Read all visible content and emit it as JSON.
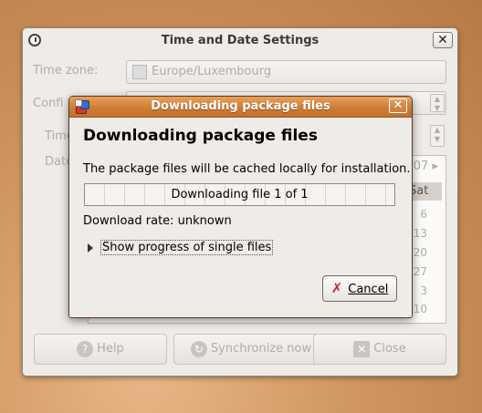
{
  "background_window": {
    "title": "Time and Date Settings",
    "close_symbol": "✕",
    "time_zone_label": "Time zone:",
    "time_zone_value": "Europe/Luxembourg",
    "config_label": "Confi",
    "time_label": "Time",
    "date_label": "Date",
    "calendar": {
      "year_fragment": "007",
      "weekday_header": "Sat",
      "day_numbers": [
        "6",
        "13",
        "20",
        "27",
        "3",
        "10"
      ]
    },
    "buttons": {
      "help": "Help",
      "synchronize": "Synchronize now",
      "close": "Close"
    }
  },
  "dialog": {
    "title": "Downloading package files",
    "heading": "Downloading package files",
    "description": "The package files will be cached locally for installation.",
    "progress": {
      "text": "Downloading file 1 of 1",
      "fraction": 0.0
    },
    "download_rate": "Download rate: unknown",
    "expander_label": "Show progress of single files",
    "cancel_label": "Cancel",
    "close_symbol": "✕"
  },
  "colors": {
    "titlebar_accent": "#cf7c36",
    "window_bg": "#efebe7",
    "cancel_icon": "#cc2222"
  },
  "icons": {
    "dialog_app": "package-icon",
    "background_app": "clock-icon",
    "help": "help-icon",
    "sync": "sync-icon",
    "close": "close-icon",
    "cancel": "cancel-x-icon",
    "expander": "expander-triangle-icon"
  }
}
